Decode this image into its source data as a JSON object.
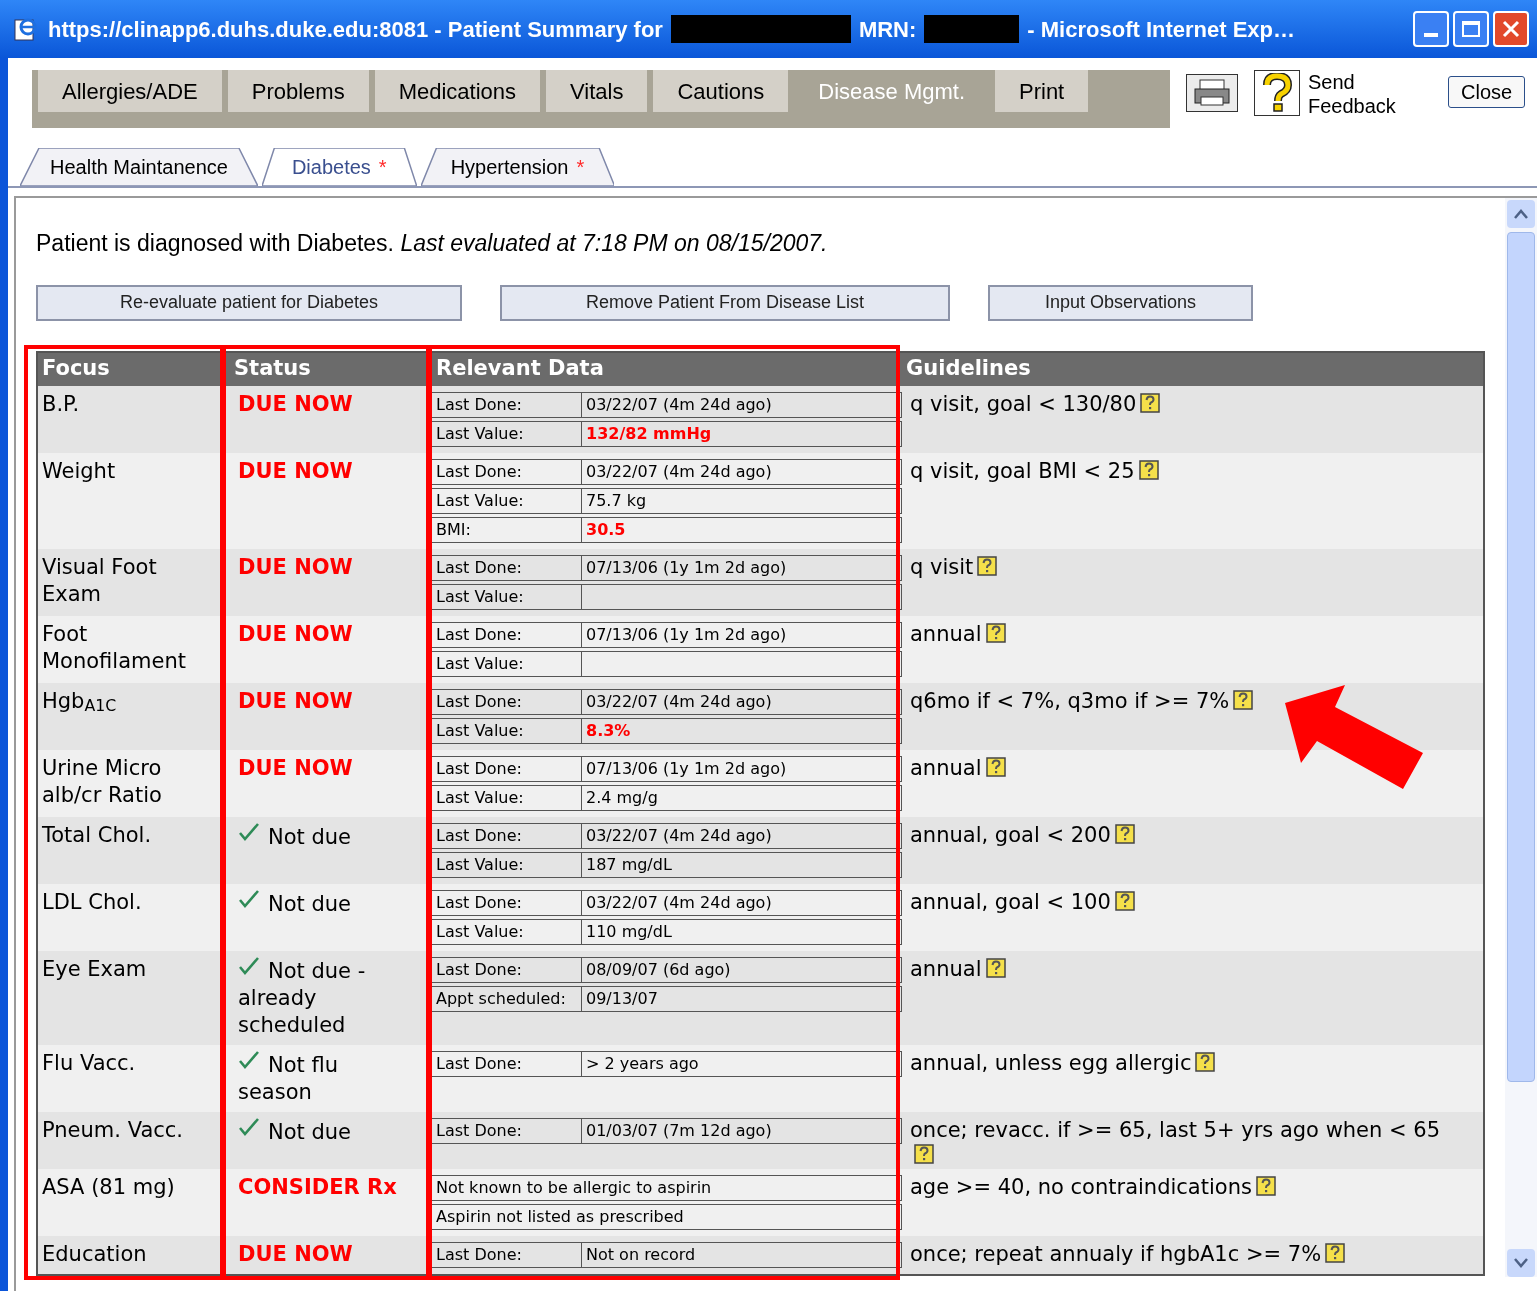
{
  "window": {
    "title": "https://clinapp6.duhs.duke.edu:8081 - Patient Summary for",
    "mrn_label": "MRN:",
    "title_suffix": "- Microsoft Internet Exp…"
  },
  "main_tabs": [
    {
      "label": "Allergies/ADE",
      "selected": false
    },
    {
      "label": "Problems",
      "selected": false
    },
    {
      "label": "Medications",
      "selected": false
    },
    {
      "label": "Vitals",
      "selected": false
    },
    {
      "label": "Cautions",
      "selected": false
    },
    {
      "label": "Disease Mgmt.",
      "selected": true
    },
    {
      "label": "Print",
      "selected": false
    }
  ],
  "feedback_link": "Send Feedback",
  "close_button": "Close",
  "sub_tabs": [
    {
      "label": "Health Maintanence",
      "selected": false
    },
    {
      "label": "Diabetes",
      "marker": "*",
      "selected": true
    },
    {
      "label": "Hypertension",
      "marker": "*",
      "selected": false
    }
  ],
  "summary": "Patient is diagnosed with Diabetes. *Last evaluated at 7:18 PM on 08/15/2007.*",
  "actions": [
    "Re-evaluate patient for Diabetes",
    "Remove Patient From Disease List",
    "Input Observations"
  ],
  "table": {
    "columns": [
      "Focus",
      "Status",
      "Relevant Data",
      "Guidelines"
    ],
    "rows": [
      {
        "focus": "B.P.",
        "status": {
          "kind": "due",
          "text": "DUE NOW"
        },
        "data": {
          "kind": "pairs",
          "items": [
            {
              "label": "Last Done:",
              "value": "03/22/07 (4m 24d ago)"
            },
            {
              "label": "Last Value:",
              "value": "132/82 mmHg",
              "alert": true
            }
          ]
        },
        "guideline": "q visit, goal < 130/80"
      },
      {
        "focus": "Weight",
        "status": {
          "kind": "due",
          "text": "DUE NOW"
        },
        "data": {
          "kind": "pairs",
          "items": [
            {
              "label": "Last Done:",
              "value": "03/22/07 (4m 24d ago)"
            },
            {
              "label": "Last Value:",
              "value": "75.7 kg"
            },
            {
              "label": "BMI:",
              "value": "30.5",
              "alert": true
            }
          ]
        },
        "guideline": "q visit, goal BMI < 25"
      },
      {
        "focus": "Visual Foot Exam",
        "status": {
          "kind": "due",
          "text": "DUE NOW"
        },
        "data": {
          "kind": "pairs",
          "items": [
            {
              "label": "Last Done:",
              "value": "07/13/06 (1y 1m 2d ago)"
            },
            {
              "label": "Last Value:"
            }
          ]
        },
        "guideline": "q visit"
      },
      {
        "focus": "Foot Monofilament",
        "status": {
          "kind": "due",
          "text": "DUE NOW"
        },
        "data": {
          "kind": "pairs",
          "items": [
            {
              "label": "Last Done:",
              "value": "07/13/06 (1y 1m 2d ago)"
            },
            {
              "label": "Last Value:"
            }
          ]
        },
        "guideline": "annual"
      },
      {
        "focus": "Hgb$_{A1C}$",
        "status": {
          "kind": "due",
          "text": "DUE NOW"
        },
        "data": {
          "kind": "pairs",
          "items": [
            {
              "label": "Last Done:",
              "value": "03/22/07 (4m 24d ago)"
            },
            {
              "label": "Last Value:",
              "value": "8.3%",
              "alert": true
            }
          ]
        },
        "guideline": "q6mo if < 7%, q3mo if >= 7%"
      },
      {
        "focus": "Urine Micro alb/cr Ratio",
        "status": {
          "kind": "due",
          "text": "DUE NOW"
        },
        "data": {
          "kind": "pairs",
          "items": [
            {
              "label": "Last Done:",
              "value": "07/13/06 (1y 1m 2d ago)"
            },
            {
              "label": "Last Value:",
              "value": "2.4 mg/g"
            }
          ]
        },
        "guideline": "annual"
      },
      {
        "focus": "Total Chol.",
        "status": {
          "kind": "ok",
          "text": "Not due"
        },
        "data": {
          "kind": "pairs",
          "items": [
            {
              "label": "Last Done:",
              "value": "03/22/07 (4m 24d ago)"
            },
            {
              "label": "Last Value:",
              "value": "187 mg/dL"
            }
          ]
        },
        "guideline": "annual, goal < 200"
      },
      {
        "focus": "LDL Chol.",
        "status": {
          "kind": "ok",
          "text": "Not due"
        },
        "data": {
          "kind": "pairs",
          "items": [
            {
              "label": "Last Done:",
              "value": "03/22/07 (4m 24d ago)"
            },
            {
              "label": "Last Value:",
              "value": "110 mg/dL"
            }
          ]
        },
        "guideline": "annual, goal < 100"
      },
      {
        "focus": "Eye Exam",
        "status": {
          "kind": "ok",
          "text": "Not due - already scheduled"
        },
        "data": {
          "kind": "pairs",
          "items": [
            {
              "label": "Last Done:",
              "value": "08/09/07 (6d ago)"
            },
            {
              "label": "Appt scheduled:",
              "value": "09/13/07"
            }
          ]
        },
        "guideline": "annual"
      },
      {
        "focus": "Flu Vacc.",
        "status": {
          "kind": "ok",
          "text": "Not flu season"
        },
        "data": {
          "kind": "pairs",
          "items": [
            {
              "label": "Last Done:",
              "value": "> 2 years ago"
            }
          ]
        },
        "guideline": "annual, unless egg allergic"
      },
      {
        "focus": "Pneum. Vacc.",
        "status": {
          "kind": "ok",
          "text": "Not due"
        },
        "data": {
          "kind": "pairs",
          "items": [
            {
              "label": "Last Done:",
              "value": "01/03/07 (7m 12d ago)"
            }
          ]
        },
        "guideline": "once; revacc. if >= 65, last 5+ yrs ago when < 65"
      },
      {
        "focus": "ASA (81 mg)",
        "status": {
          "kind": "due",
          "text": "CONSIDER Rx"
        },
        "data": {
          "kind": "lines",
          "items": [
            {
              "text": "Not known to be allergic to aspirin"
            },
            {
              "text": "Aspirin not listed as prescribed"
            }
          ]
        },
        "guideline": "age >= 40, no contraindications"
      },
      {
        "focus": "Education",
        "status": {
          "kind": "due",
          "text": "DUE NOW"
        },
        "data": {
          "kind": "pairs",
          "items": [
            {
              "label": "Last Done:",
              "value": "Not on record"
            }
          ]
        },
        "guideline": "once; repeat annualy if hgbA1c >= 7%"
      }
    ]
  }
}
